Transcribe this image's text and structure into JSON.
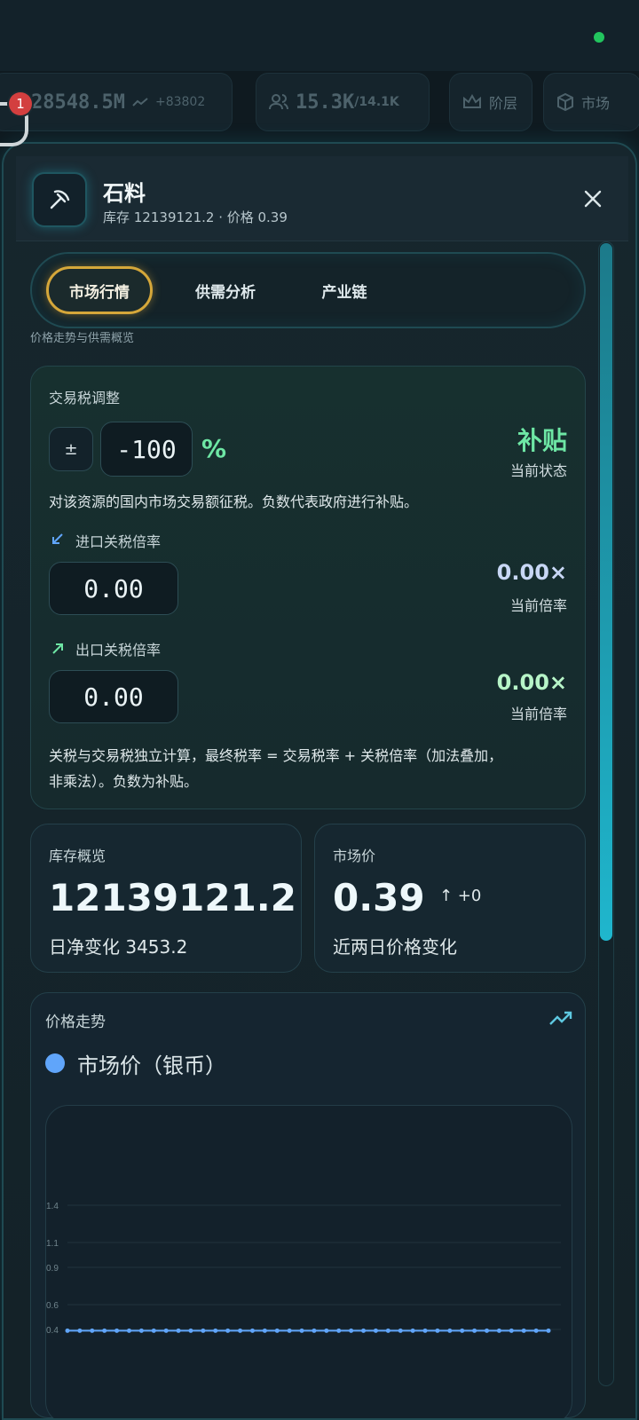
{
  "background": {
    "stats": {
      "money": "28548.5M",
      "money_change": "+83802",
      "population": "15.3K",
      "population_cap": "/14.1K",
      "class_label": "阶层",
      "market_label": "市场"
    },
    "notification_count": "1"
  },
  "panel": {
    "title": "石料",
    "subtitle": "库存 12139121.2 · 价格 0.39",
    "tabs": [
      {
        "label": "市场行情",
        "active": true
      },
      {
        "label": "供需分析",
        "active": false
      },
      {
        "label": "产业链",
        "active": false
      }
    ],
    "tab_hint": "价格走势与供需概览"
  },
  "tax": {
    "title": "交易税调整",
    "sign_label": "±",
    "value": "-100",
    "unit": "%",
    "status": "补贴",
    "status_caption": "当前状态",
    "description": "对该资源的国内市场交易额征税。负数代表政府进行补贴。",
    "import": {
      "label": "进口关税倍率",
      "value": "0.00",
      "current": "0.00×",
      "caption": "当前倍率"
    },
    "export": {
      "label": "出口关税倍率",
      "value": "0.00",
      "current": "0.00×",
      "caption": "当前倍率"
    },
    "note_line1": "关税与交易税独立计算，最终税率 = 交易税率 + 关税倍率（加法叠加，",
    "note_line2": "非乘法）。负数为补贴。"
  },
  "inventory": {
    "label": "库存概览",
    "value": "12139121.2",
    "change": "日净变化 3453.2"
  },
  "market_price": {
    "label": "市场价",
    "value": "0.39",
    "change": "↑ +0",
    "caption": "近两日价格变化"
  },
  "chart": {
    "title": "价格走势",
    "legend": "市场价（银币）"
  },
  "chart_data": {
    "type": "line",
    "series": [
      {
        "name": "市场价（银币）",
        "values": [
          0.39,
          0.39,
          0.39,
          0.39,
          0.39,
          0.39,
          0.39,
          0.39,
          0.39,
          0.39,
          0.39,
          0.39,
          0.39,
          0.39,
          0.39,
          0.39,
          0.39,
          0.39,
          0.39,
          0.39,
          0.39,
          0.39,
          0.39,
          0.39,
          0.39,
          0.39,
          0.39,
          0.39,
          0.39,
          0.39,
          0.39,
          0.39,
          0.39,
          0.39,
          0.39,
          0.39,
          0.39,
          0.39,
          0.39,
          0.39
        ]
      }
    ],
    "y_ticks": [
      "1.4",
      "1.1",
      "0.9",
      "0.6",
      "0.4"
    ],
    "ylim": [
      0.4,
      1.4
    ],
    "grid": true,
    "colors": {
      "line": "#60a5fa"
    }
  }
}
